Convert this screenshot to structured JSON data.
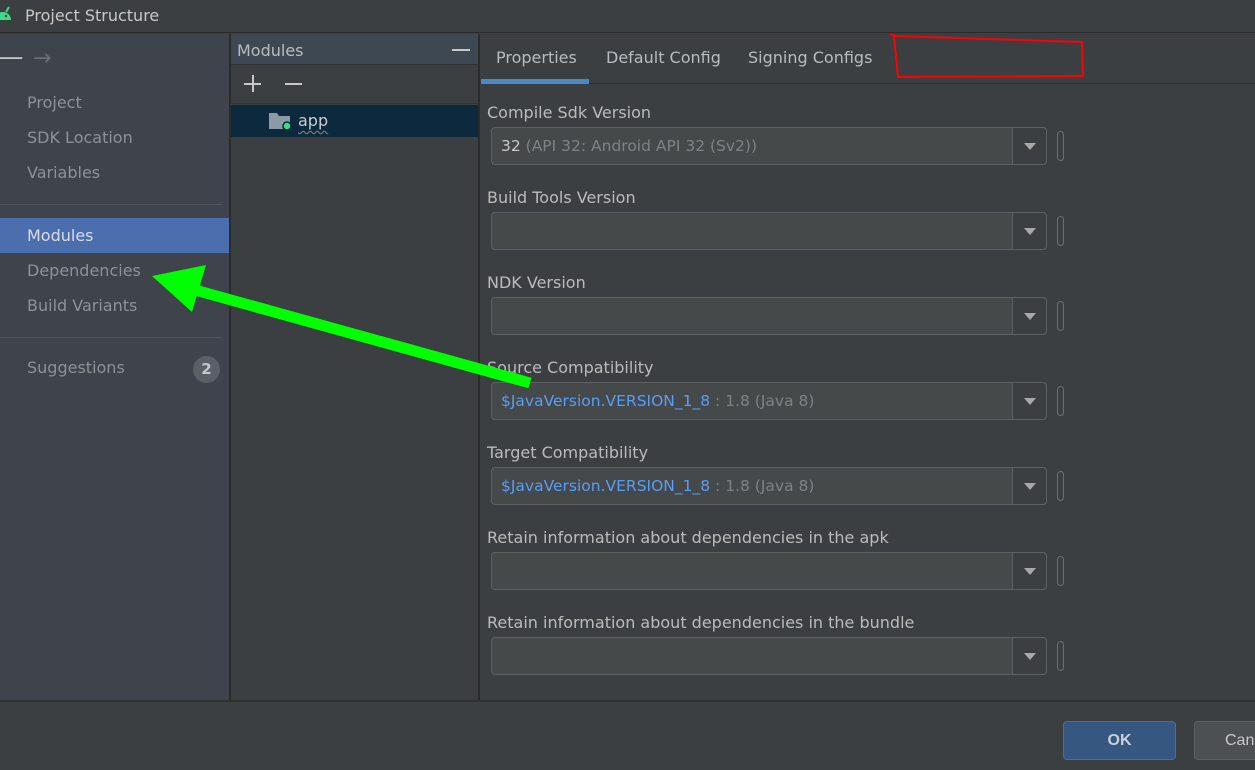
{
  "window": {
    "title": "Project Structure",
    "app_icon": "android-icon"
  },
  "nav": {
    "back_icon": "back-arrow-icon",
    "forward_icon": "forward-arrow-icon",
    "items": [
      {
        "label": "Project"
      },
      {
        "label": "SDK Location"
      },
      {
        "label": "Variables"
      },
      {
        "label": "Modules",
        "selected": true
      },
      {
        "label": "Dependencies"
      },
      {
        "label": "Build Variants"
      },
      {
        "label": "Suggestions",
        "badge": "2"
      }
    ]
  },
  "modules": {
    "header": "Modules",
    "toolbar": {
      "add": "add-icon",
      "remove": "remove-icon"
    },
    "items": [
      {
        "name": "app",
        "selected": true
      }
    ]
  },
  "tabs": [
    {
      "label": "Properties",
      "active": true
    },
    {
      "label": "Default Config"
    },
    {
      "label": "Signing Configs"
    }
  ],
  "fields": [
    {
      "label": "Compile Sdk Version",
      "value_main": "32",
      "value_dim": " (API 32: Android API 32 (Sv2))"
    },
    {
      "label": "Build Tools Version",
      "value_main": "",
      "value_dim": ""
    },
    {
      "label": "NDK Version",
      "value_main": "",
      "value_dim": ""
    },
    {
      "label": "Source Compatibility",
      "value_link": "$JavaVersion.VERSION_1_8",
      "value_dim": " : 1.8 (Java 8)"
    },
    {
      "label": "Target Compatibility",
      "value_link": "$JavaVersion.VERSION_1_8",
      "value_dim": " : 1.8 (Java 8)"
    },
    {
      "label": "Retain information about dependencies in the apk",
      "value_main": "",
      "value_dim": ""
    },
    {
      "label": "Retain information about dependencies in the bundle",
      "value_main": "",
      "value_dim": ""
    }
  ],
  "footer": {
    "ok": "OK",
    "cancel": "Cancel"
  },
  "annotations": {
    "arrow_color": "#00ff00",
    "box_color": "#ff0000"
  },
  "colors": {
    "accent": "#4b6eaf",
    "tab_underline": "#4a88c7",
    "link": "#589df6",
    "ok_button": "#365880"
  }
}
